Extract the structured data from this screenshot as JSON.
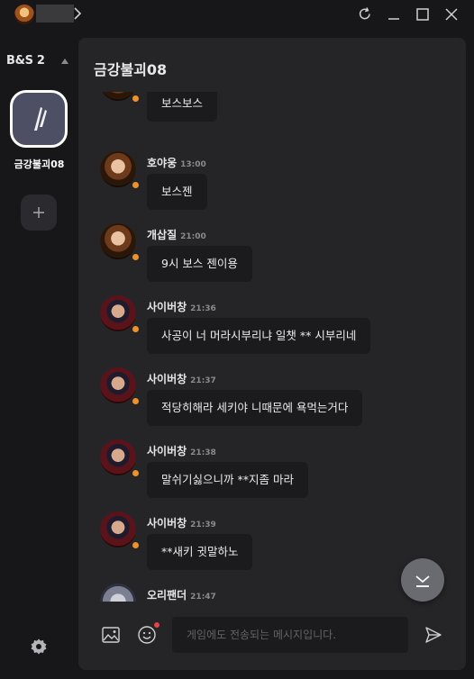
{
  "sidebar": {
    "server_name": "B&S 2",
    "room_name": "금강불괴08",
    "add_label": "+"
  },
  "chat": {
    "title": "금강불괴08",
    "messages": [
      {
        "nick": "",
        "time": "",
        "text": "보스보스",
        "avatar": "girl"
      },
      {
        "nick": "호야웅",
        "time": "13:00",
        "text": "보스젠",
        "avatar": "girl"
      },
      {
        "nick": "개삽질",
        "time": "21:00",
        "text": "9시 보스 젠이용",
        "avatar": "girl"
      },
      {
        "nick": "사이버창",
        "time": "21:36",
        "text": "사공이 너 머라시부리냐  일챗 ** 시부리네",
        "avatar": "boy"
      },
      {
        "nick": "사이버창",
        "time": "21:37",
        "text": "적당히해라 세키야 니때문에 욕먹는거다",
        "avatar": "boy"
      },
      {
        "nick": "사이버창",
        "time": "21:38",
        "text": "말쉬기싫으니까 **지좀 마라",
        "avatar": "boy"
      },
      {
        "nick": "사이버창",
        "time": "21:39",
        "text": "**새키 귓말하노",
        "avatar": "boy"
      },
      {
        "nick": "오리팬더",
        "time": "21:47",
        "text": "",
        "avatar": "silver"
      }
    ]
  },
  "composer": {
    "placeholder": "게임에도 전송되는 메시지입니다."
  },
  "colors": {
    "background": "#17171a",
    "panel": "#252528",
    "bubble": "#1b1b1e",
    "status_online": "#f0902a",
    "notification_dot": "#e84141"
  },
  "icons": {
    "titlebar": [
      "refresh-icon",
      "minimize-icon",
      "maximize-icon",
      "close-icon"
    ],
    "composer": [
      "image-icon",
      "emoji-icon",
      "send-icon"
    ],
    "fab": "chevron-down-icon",
    "rail": [
      "caret-up-icon",
      "plus-icon",
      "settings-gear-icon"
    ]
  }
}
